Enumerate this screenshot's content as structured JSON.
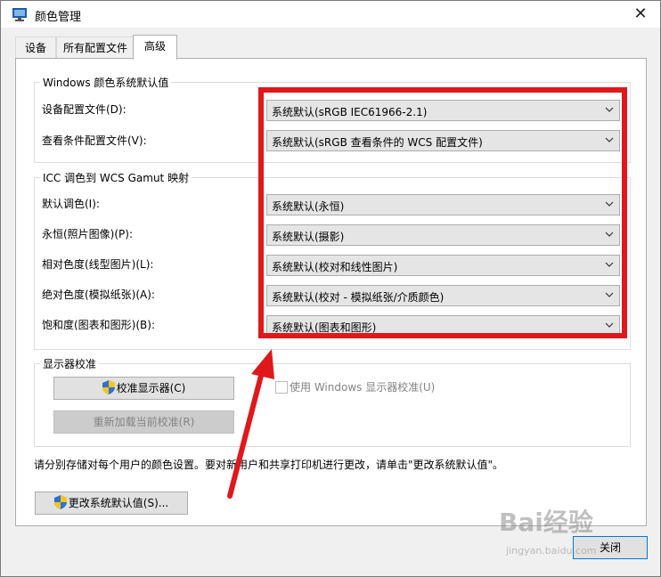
{
  "window": {
    "title": "颜色管理",
    "close_glyph": "✕"
  },
  "tabs": [
    {
      "label": "设备",
      "active": false
    },
    {
      "label": "所有配置文件",
      "active": false
    },
    {
      "label": "高级",
      "active": true
    }
  ],
  "windows_defaults": {
    "title": "Windows 颜色系统默认值",
    "rows": [
      {
        "label": "设备配置文件(D):",
        "value": "系统默认(sRGB IEC61966-2.1)"
      },
      {
        "label": "查看条件配置文件(V):",
        "value": "系统默认(sRGB 查看条件的 WCS 配置文件)"
      }
    ]
  },
  "icc_mapping": {
    "title": "ICC 调色到 WCS Gamut 映射",
    "rows": [
      {
        "label": "默认调色(I):",
        "value": "系统默认(永恒)"
      },
      {
        "label": "永恒(照片图像)(P):",
        "value": "系统默认(摄影)"
      },
      {
        "label": "相对色度(线型图片)(L):",
        "value": "系统默认(校对和线性图片)"
      },
      {
        "label": "绝对色度(模拟纸张)(A):",
        "value": "系统默认(校对 - 模拟纸张/介质颜色)"
      },
      {
        "label": "饱和度(图表和图形)(B):",
        "value": "系统默认(图表和图形)"
      }
    ]
  },
  "calibration": {
    "title": "显示器校准",
    "calibrate_button": "校准显示器(C)",
    "reload_button": "重新加载当前校准(R)",
    "use_windows_calibration": "使用 Windows 显示器校准(U)"
  },
  "description": "请分别存储对每个用户的颜色设置。要对新用户和共享打印机进行更改，请单击\"更改系统默认值\"。",
  "change_defaults_button": "更改系统默认值(S)...",
  "close_button": "关闭",
  "overlay": {
    "highlight_color": "#e0181b"
  },
  "watermark": {
    "text": "Bai经验",
    "url": "jingyan.baidu.com"
  }
}
